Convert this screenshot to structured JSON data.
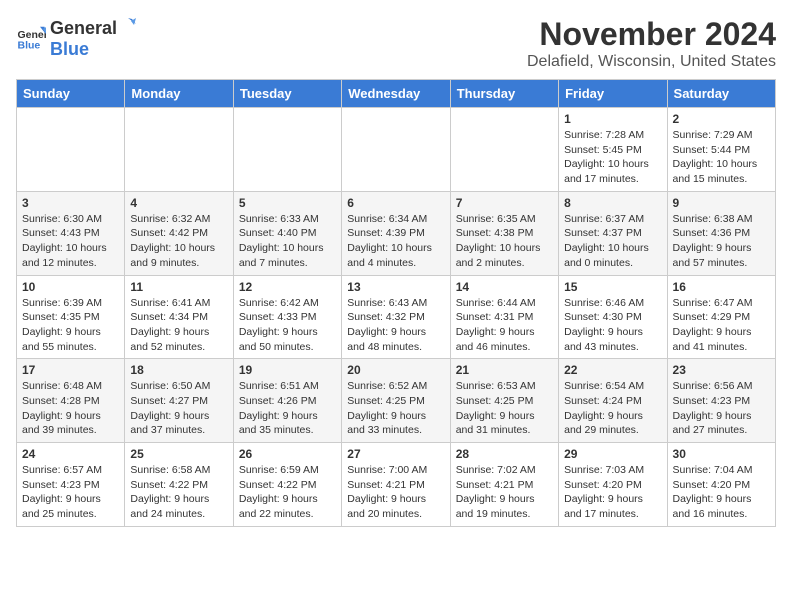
{
  "header": {
    "logo_general": "General",
    "logo_blue": "Blue",
    "month": "November 2024",
    "location": "Delafield, Wisconsin, United States"
  },
  "days_of_week": [
    "Sunday",
    "Monday",
    "Tuesday",
    "Wednesday",
    "Thursday",
    "Friday",
    "Saturday"
  ],
  "weeks": [
    [
      {
        "day": "",
        "info": ""
      },
      {
        "day": "",
        "info": ""
      },
      {
        "day": "",
        "info": ""
      },
      {
        "day": "",
        "info": ""
      },
      {
        "day": "",
        "info": ""
      },
      {
        "day": "1",
        "info": "Sunrise: 7:28 AM\nSunset: 5:45 PM\nDaylight: 10 hours and 17 minutes."
      },
      {
        "day": "2",
        "info": "Sunrise: 7:29 AM\nSunset: 5:44 PM\nDaylight: 10 hours and 15 minutes."
      }
    ],
    [
      {
        "day": "3",
        "info": "Sunrise: 6:30 AM\nSunset: 4:43 PM\nDaylight: 10 hours and 12 minutes."
      },
      {
        "day": "4",
        "info": "Sunrise: 6:32 AM\nSunset: 4:42 PM\nDaylight: 10 hours and 9 minutes."
      },
      {
        "day": "5",
        "info": "Sunrise: 6:33 AM\nSunset: 4:40 PM\nDaylight: 10 hours and 7 minutes."
      },
      {
        "day": "6",
        "info": "Sunrise: 6:34 AM\nSunset: 4:39 PM\nDaylight: 10 hours and 4 minutes."
      },
      {
        "day": "7",
        "info": "Sunrise: 6:35 AM\nSunset: 4:38 PM\nDaylight: 10 hours and 2 minutes."
      },
      {
        "day": "8",
        "info": "Sunrise: 6:37 AM\nSunset: 4:37 PM\nDaylight: 10 hours and 0 minutes."
      },
      {
        "day": "9",
        "info": "Sunrise: 6:38 AM\nSunset: 4:36 PM\nDaylight: 9 hours and 57 minutes."
      }
    ],
    [
      {
        "day": "10",
        "info": "Sunrise: 6:39 AM\nSunset: 4:35 PM\nDaylight: 9 hours and 55 minutes."
      },
      {
        "day": "11",
        "info": "Sunrise: 6:41 AM\nSunset: 4:34 PM\nDaylight: 9 hours and 52 minutes."
      },
      {
        "day": "12",
        "info": "Sunrise: 6:42 AM\nSunset: 4:33 PM\nDaylight: 9 hours and 50 minutes."
      },
      {
        "day": "13",
        "info": "Sunrise: 6:43 AM\nSunset: 4:32 PM\nDaylight: 9 hours and 48 minutes."
      },
      {
        "day": "14",
        "info": "Sunrise: 6:44 AM\nSunset: 4:31 PM\nDaylight: 9 hours and 46 minutes."
      },
      {
        "day": "15",
        "info": "Sunrise: 6:46 AM\nSunset: 4:30 PM\nDaylight: 9 hours and 43 minutes."
      },
      {
        "day": "16",
        "info": "Sunrise: 6:47 AM\nSunset: 4:29 PM\nDaylight: 9 hours and 41 minutes."
      }
    ],
    [
      {
        "day": "17",
        "info": "Sunrise: 6:48 AM\nSunset: 4:28 PM\nDaylight: 9 hours and 39 minutes."
      },
      {
        "day": "18",
        "info": "Sunrise: 6:50 AM\nSunset: 4:27 PM\nDaylight: 9 hours and 37 minutes."
      },
      {
        "day": "19",
        "info": "Sunrise: 6:51 AM\nSunset: 4:26 PM\nDaylight: 9 hours and 35 minutes."
      },
      {
        "day": "20",
        "info": "Sunrise: 6:52 AM\nSunset: 4:25 PM\nDaylight: 9 hours and 33 minutes."
      },
      {
        "day": "21",
        "info": "Sunrise: 6:53 AM\nSunset: 4:25 PM\nDaylight: 9 hours and 31 minutes."
      },
      {
        "day": "22",
        "info": "Sunrise: 6:54 AM\nSunset: 4:24 PM\nDaylight: 9 hours and 29 minutes."
      },
      {
        "day": "23",
        "info": "Sunrise: 6:56 AM\nSunset: 4:23 PM\nDaylight: 9 hours and 27 minutes."
      }
    ],
    [
      {
        "day": "24",
        "info": "Sunrise: 6:57 AM\nSunset: 4:23 PM\nDaylight: 9 hours and 25 minutes."
      },
      {
        "day": "25",
        "info": "Sunrise: 6:58 AM\nSunset: 4:22 PM\nDaylight: 9 hours and 24 minutes."
      },
      {
        "day": "26",
        "info": "Sunrise: 6:59 AM\nSunset: 4:22 PM\nDaylight: 9 hours and 22 minutes."
      },
      {
        "day": "27",
        "info": "Sunrise: 7:00 AM\nSunset: 4:21 PM\nDaylight: 9 hours and 20 minutes."
      },
      {
        "day": "28",
        "info": "Sunrise: 7:02 AM\nSunset: 4:21 PM\nDaylight: 9 hours and 19 minutes."
      },
      {
        "day": "29",
        "info": "Sunrise: 7:03 AM\nSunset: 4:20 PM\nDaylight: 9 hours and 17 minutes."
      },
      {
        "day": "30",
        "info": "Sunrise: 7:04 AM\nSunset: 4:20 PM\nDaylight: 9 hours and 16 minutes."
      }
    ]
  ]
}
